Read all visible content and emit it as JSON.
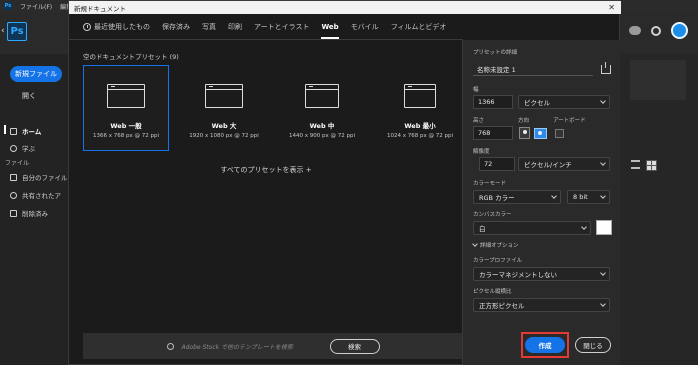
{
  "app": {
    "menu": [
      "ファイル(F)",
      "編集(E)"
    ],
    "logo": "Ps"
  },
  "sidebar": {
    "new_file": "新規ファイル",
    "open": "開く",
    "items": [
      {
        "label": "ホーム",
        "icon": "home-icon",
        "active": true
      },
      {
        "label": "学ぶ",
        "icon": "lightbulb-icon",
        "active": false
      }
    ],
    "section": "ファイル",
    "files": [
      {
        "label": "自分のファイル",
        "icon": "file-icon"
      },
      {
        "label": "共有されたア",
        "icon": "people-icon"
      },
      {
        "label": "削除済み",
        "icon": "trash-icon"
      }
    ]
  },
  "dialog": {
    "title": "新規ドキュメント",
    "tabs": [
      {
        "label": "最近使用したもの",
        "active": false
      },
      {
        "label": "保存済み",
        "active": false
      },
      {
        "label": "写真",
        "active": false
      },
      {
        "label": "印刷",
        "active": false
      },
      {
        "label": "アートとイラスト",
        "active": false
      },
      {
        "label": "Web",
        "active": true
      },
      {
        "label": "モバイル",
        "active": false
      },
      {
        "label": "フィルムとビデオ",
        "active": false
      }
    ],
    "presets_heading": "空のドキュメントプリセット (9)",
    "presets": [
      {
        "name": "Web 一般",
        "size": "1366 x 768 px @ 72 ppi",
        "selected": true
      },
      {
        "name": "Web 大",
        "size": "1920 x 1080 px @ 72 ppi",
        "selected": false
      },
      {
        "name": "Web 中",
        "size": "1440 x 900 px @ 72 ppi",
        "selected": false
      },
      {
        "name": "Web 最小",
        "size": "1024 x 768 px @ 72 ppi",
        "selected": false
      }
    ],
    "view_all": "すべてのプリセットを表示 +",
    "stock_placeholder": "Adobe Stock で他のテンプレートを検索",
    "stock_search_button": "検索",
    "details": {
      "heading": "プリセットの詳細",
      "name": "名称未設定 1",
      "width_label": "幅",
      "width_value": "1366",
      "width_unit": "ピクセル",
      "height_label": "高さ",
      "height_value": "768",
      "orientation_label": "方向",
      "artboard_label": "アートボード",
      "resolution_label": "解像度",
      "resolution_value": "72",
      "resolution_unit": "ピクセル/インチ",
      "color_mode_label": "カラーモード",
      "color_mode_value": "RGB カラー",
      "bit_depth_value": "8 bit",
      "canvas_color_label": "カンバスカラー",
      "canvas_color_value": "白",
      "advanced_label": "詳細オプション",
      "color_profile_label": "カラープロファイル",
      "color_profile_value": "カラーマネジメントしない",
      "pixel_aspect_label": "ピクセル縦横比",
      "pixel_aspect_value": "正方形ピクセル"
    },
    "create_button": "作成",
    "close_button": "閉じる"
  },
  "colors": {
    "accent": "#1473e6",
    "highlight": "#e53935"
  }
}
